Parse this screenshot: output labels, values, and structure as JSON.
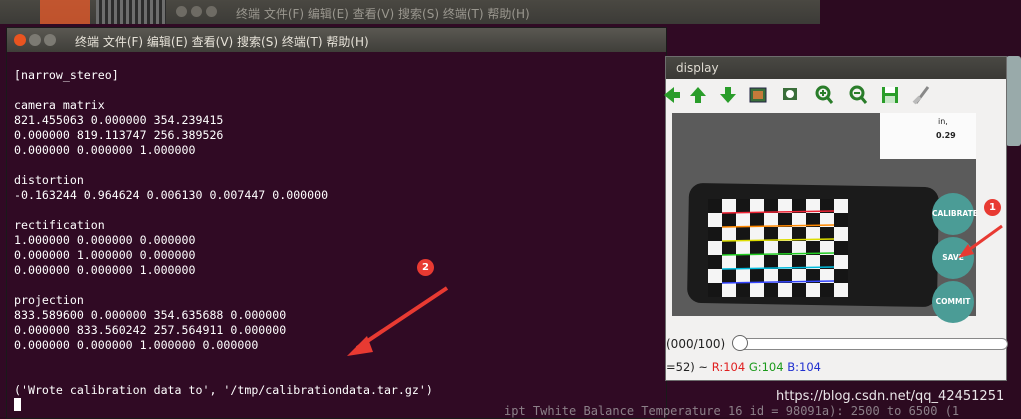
{
  "background_window": {
    "title": "终端  文件(F)  编辑(E)  查看(V)  搜索(S)  终端(T)  帮助(H)"
  },
  "terminal": {
    "title": "终端  文件(F)  编辑(E)  查看(V)  搜索(S)  终端(T)  帮助(H)",
    "lines": [
      "[narrow_stereo]",
      "",
      "camera matrix",
      "821.455063 0.000000 354.239415",
      "0.000000 819.113747 256.389526",
      "0.000000 0.000000 1.000000",
      "",
      "distortion",
      "-0.163244 0.964624 0.006130 0.007447 0.000000",
      "",
      "rectification",
      "1.000000 0.000000 0.000000",
      "0.000000 1.000000 0.000000",
      "0.000000 0.000000 1.000000",
      "",
      "projection",
      "833.589600 0.000000 354.635688 0.000000",
      "0.000000 833.560242 257.564911 0.000000",
      "0.000000 0.000000 1.000000 0.000000",
      "",
      "",
      "('Wrote calibration data to', '/tmp/calibrationdata.tar.gz')"
    ]
  },
  "display_window": {
    "title": "display",
    "toolbar_icons": [
      "arrow-left-icon",
      "arrow-up-icon",
      "arrow-down-icon",
      "image-icon",
      "fit-icon",
      "zoom-in-icon",
      "zoom-out-icon",
      "save-icon",
      "brush-icon"
    ],
    "image_texts": {
      "paper_line1": "in,",
      "paper_line2": "0.29"
    },
    "buttons": {
      "calibrate": "CALIBRATE",
      "save": "SAVE",
      "commit": "COMMIT"
    },
    "slider_label": "(000/100)",
    "slider_value": 0,
    "status_prefix": "=52) ~ ",
    "status_r": "R:104",
    "status_g": "G:104",
    "status_b": "B:104"
  },
  "annotations": {
    "badge1": "1",
    "badge2": "2"
  },
  "watermark": "https://blog.csdn.net/qq_42451251",
  "background_text": "ipt Twhite Balance Temperature  16  id = 98091a): 2500 to 6500 (1",
  "colors": {
    "terminal_bg": "#300a24",
    "accent_red": "#e83a32",
    "button_teal": "#4b9c96",
    "arrow_red": "#e83a32"
  }
}
